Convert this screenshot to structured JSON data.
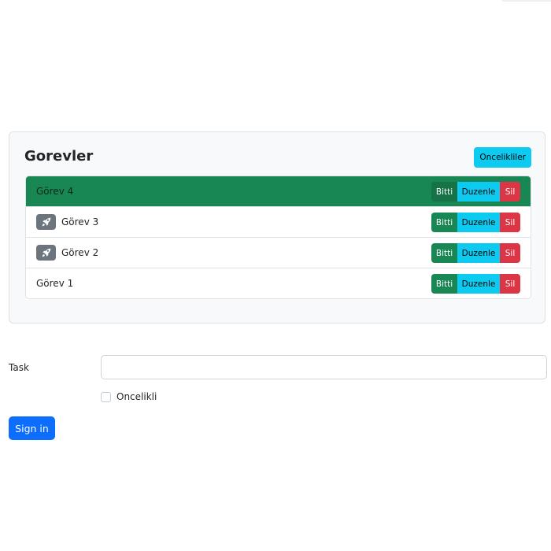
{
  "card": {
    "title": "Gorevler",
    "priorities_button": "Oncelikliler"
  },
  "tasks": [
    {
      "name": "Görev 4",
      "done": true,
      "priority": false
    },
    {
      "name": "Görev 3",
      "done": false,
      "priority": true,
      "icon": "rocket-icon"
    },
    {
      "name": "Görev 2",
      "done": false,
      "priority": true,
      "icon": "rocket-icon"
    },
    {
      "name": "Görev 1",
      "done": false,
      "priority": false
    }
  ],
  "actions": {
    "done_label": "Bitti",
    "edit_label": "Duzenle",
    "delete_label": "Sil"
  },
  "form": {
    "task_label": "Task",
    "task_value": "",
    "priority_label": "Oncelikli",
    "priority_checked": false,
    "submit_label": "Sign in"
  },
  "colors": {
    "success": "#198754",
    "info": "#0dcaf0",
    "danger": "#dc3545",
    "primary": "#0d6efd",
    "secondary": "#6c757d"
  }
}
